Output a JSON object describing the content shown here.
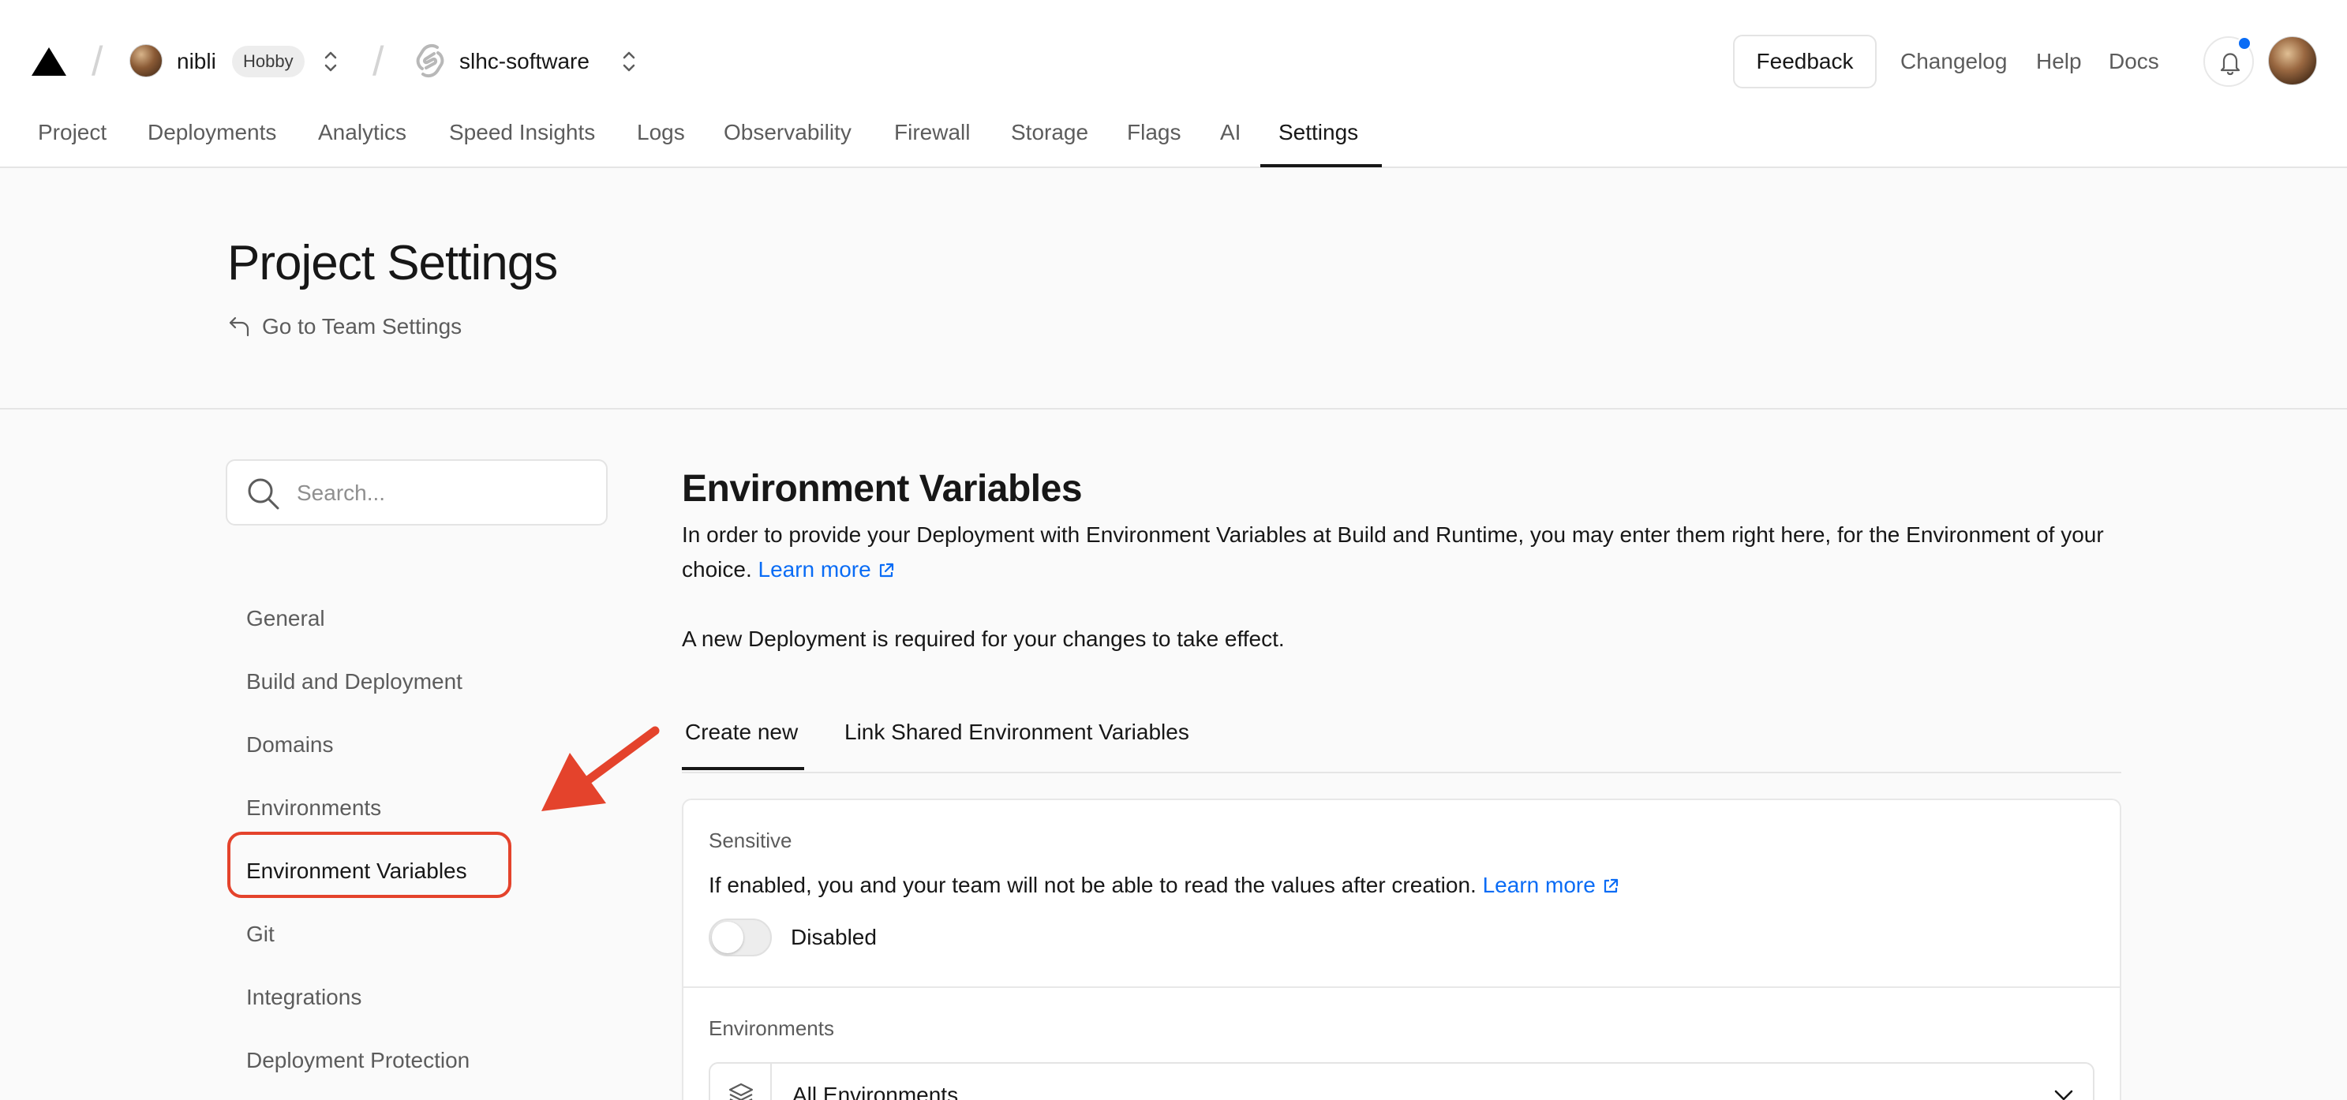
{
  "header": {
    "team": {
      "name": "nibli",
      "plan_badge": "Hobby"
    },
    "project": {
      "name": "slhc-software"
    },
    "feedback_label": "Feedback",
    "links": [
      "Changelog",
      "Help",
      "Docs"
    ],
    "notification_dot_color": "#0a6cf5"
  },
  "nav": {
    "tabs": [
      "Project",
      "Deployments",
      "Analytics",
      "Speed Insights",
      "Logs",
      "Observability",
      "Firewall",
      "Storage",
      "Flags",
      "AI",
      "Settings"
    ],
    "active": "Settings"
  },
  "page": {
    "title": "Project Settings",
    "back_link": "Go to Team Settings"
  },
  "sidebar": {
    "search_placeholder": "Search...",
    "items": [
      "General",
      "Build and Deployment",
      "Domains",
      "Environments",
      "Environment Variables",
      "Git",
      "Integrations",
      "Deployment Protection"
    ],
    "active": "Environment Variables",
    "annotation_color": "#e4432c"
  },
  "main": {
    "title": "Environment Variables",
    "description": "In order to provide your Deployment with Environment Variables at Build and Runtime, you may enter them right here, for the Environment of your choice.",
    "learn_more": "Learn more",
    "note": "A new Deployment is required for your changes to take effect.",
    "tabs": [
      "Create new",
      "Link Shared Environment Variables"
    ],
    "active_tab": "Create new",
    "sensitive": {
      "label": "Sensitive",
      "text": "If enabled, you and your team will not be able to read the values after creation.",
      "learn_more": "Learn more",
      "toggle_state": "Disabled"
    },
    "environments": {
      "label": "Environments",
      "selected": "All Environments"
    }
  }
}
